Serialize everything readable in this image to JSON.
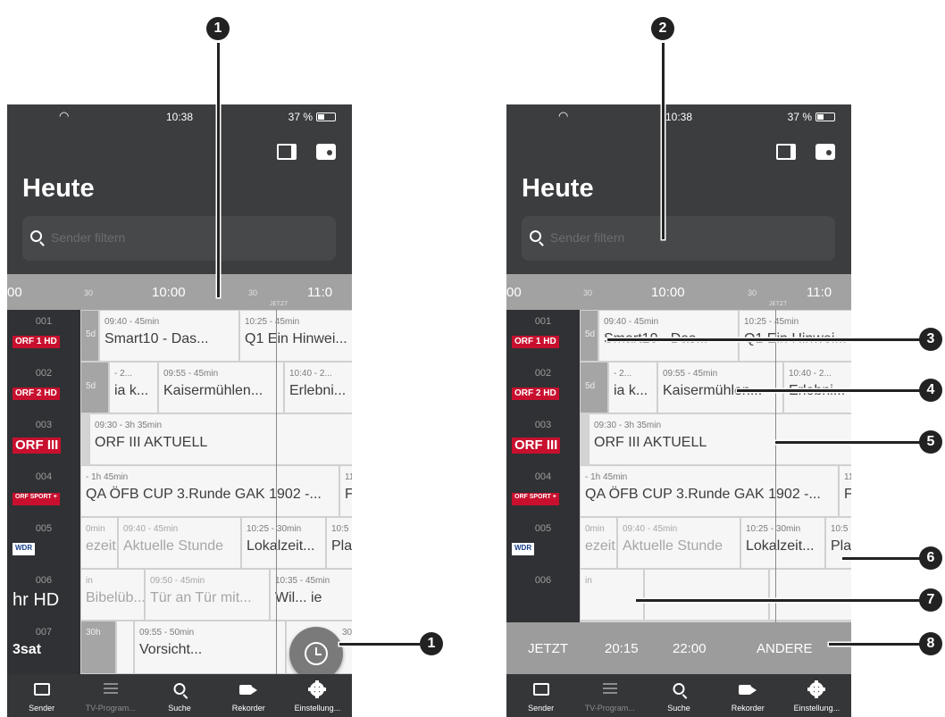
{
  "status_time": "10:38",
  "battery": "37 %",
  "header_title": "Heute",
  "search_placeholder": "Sender filtern",
  "time_axis": {
    "t00": "00",
    "t30a": "30",
    "t1000": "10:00",
    "t30b": "30",
    "t1100": "11:0",
    "now_label": "JETZT"
  },
  "channels": [
    {
      "number": "001",
      "logo": "ORF 1 HD"
    },
    {
      "number": "002",
      "logo": "ORF 2 HD"
    },
    {
      "number": "003",
      "logo": "ORF III"
    },
    {
      "number": "004",
      "logo": "ORF SPORT +"
    },
    {
      "number": "005",
      "logo": "WDR"
    },
    {
      "number": "006",
      "logo": "hr HD"
    },
    {
      "number": "007",
      "logo": "3sat"
    }
  ],
  "programs": {
    "r1": [
      {
        "time": "5d",
        "title": ""
      },
      {
        "time": "09:40 - 45min",
        "title": "Smart10 - Das..."
      },
      {
        "time": "10:25 - 45min",
        "title": "Q1 Ein Hinwei..."
      }
    ],
    "r2": [
      {
        "time": "5d",
        "title": ""
      },
      {
        "time": "- 2...",
        "title": "ia k..."
      },
      {
        "time": "09:55 - 45min",
        "title": "Kaisermühlen..."
      },
      {
        "time": "10:40 - 2...",
        "title": "Erlebni..."
      }
    ],
    "r3": [
      {
        "time": "09:30 - 3h 35min",
        "title": "ORF III AKTUELL"
      }
    ],
    "r4": [
      {
        "time": "- 1h 45min",
        "title": "QA ÖFB CUP 3.Runde GAK 1902 -..."
      },
      {
        "time": "11",
        "title": "F"
      }
    ],
    "r5": [
      {
        "time": "0min",
        "title": "ezeit"
      },
      {
        "time": "09:40 - 45min",
        "title": "Aktuelle Stunde"
      },
      {
        "time": "10:25 - 30min",
        "title": "Lokalzeit..."
      },
      {
        "time": "10:5",
        "title": "Plar"
      }
    ],
    "r6": [
      {
        "time": "in",
        "title": "Bibelüb..."
      },
      {
        "time": "09:50 - 45min",
        "title": "Tür an Tür mit..."
      },
      {
        "time": "10:35 - 45min",
        "title": "Wil... ie"
      }
    ],
    "r7": [
      {
        "time": "30h",
        "title": ""
      },
      {
        "time": "09:55 - 50min",
        "title": "Vorsicht..."
      },
      {
        "time": "30",
        "title": ""
      }
    ]
  },
  "time_select": {
    "now": "JETZT",
    "t2015": "20:15",
    "t2200": "22:00",
    "other": "ANDERE"
  },
  "nav": {
    "sender": "Sender",
    "tv_program": "TV-Program...",
    "suche": "Suche",
    "rekorder": "Rekorder",
    "einstellungen": "Einstellung..."
  },
  "callouts": {
    "c1": "1",
    "c2": "2",
    "c3": "3",
    "c4": "4",
    "c5": "5",
    "c6": "6",
    "c7": "7",
    "c8": "8"
  }
}
